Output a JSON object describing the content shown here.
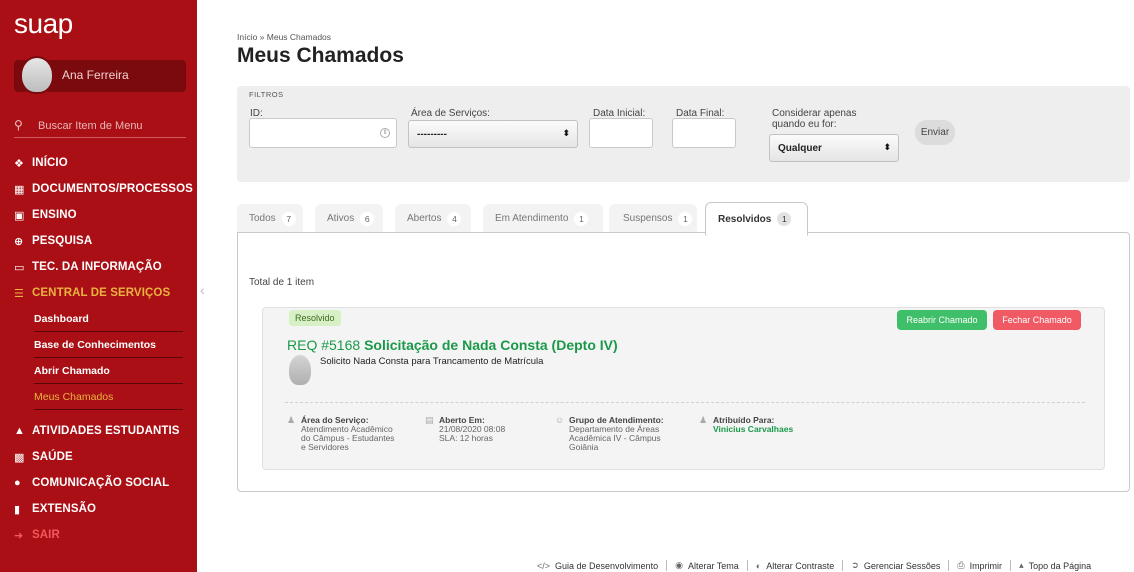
{
  "app": {
    "logo": "suap"
  },
  "user": {
    "name": "Ana Ferreira"
  },
  "search": {
    "placeholder": "Buscar Item de Menu"
  },
  "menu": {
    "items": [
      {
        "label": "INÍCIO",
        "icon": "home-icon"
      },
      {
        "label": "DOCUMENTOS/PROCESSOS",
        "icon": "documents-icon"
      },
      {
        "label": "ENSINO",
        "icon": "teaching-icon"
      },
      {
        "label": "PESQUISA",
        "icon": "research-icon"
      },
      {
        "label": "TEC. DA INFORMAÇÃO",
        "icon": "monitor-icon"
      },
      {
        "label": "CENTRAL DE SERVIÇOS",
        "icon": "list-icon"
      }
    ],
    "submenu": [
      {
        "label": "Dashboard"
      },
      {
        "label": "Base de Conhecimentos"
      },
      {
        "label": "Abrir Chamado"
      },
      {
        "label": "Meus Chamados"
      }
    ],
    "items_after": [
      {
        "label": "ATIVIDADES ESTUDANTIS",
        "icon": "graduation-icon"
      },
      {
        "label": "SAÚDE",
        "icon": "health-icon"
      },
      {
        "label": "COMUNICAÇÃO SOCIAL",
        "icon": "chat-icon"
      },
      {
        "label": "EXTENSÃO",
        "icon": "extension-icon"
      },
      {
        "label": "SAIR",
        "icon": "logout-icon"
      }
    ]
  },
  "breadcrumb": "Início » Meus Chamados",
  "page_title": "Meus Chamados",
  "filters": {
    "title": "FILTROS",
    "id_label": "ID:",
    "area_label": "Área de Serviços:",
    "area_value": "---------",
    "start_date_label": "Data Inicial:",
    "end_date_label": "Data Final:",
    "consider_label_1": "Considerar apenas",
    "consider_label_2": "quando eu for:",
    "consider_value": "Qualquer",
    "send_label": "Enviar"
  },
  "tabs": [
    {
      "label": "Todos",
      "count": "7"
    },
    {
      "label": "Ativos",
      "count": "6"
    },
    {
      "label": "Abertos",
      "count": "4"
    },
    {
      "label": "Em Atendimento",
      "count": "1"
    },
    {
      "label": "Suspensos",
      "count": "1"
    },
    {
      "label": "Resolvidos",
      "count": "1"
    }
  ],
  "panel": {
    "total": "Total de 1 item"
  },
  "ticket": {
    "status": "Resolvido",
    "reopen_label": "Reabrir Chamado",
    "close_label": "Fechar Chamado",
    "number": "REQ #5168",
    "title": "Solicitação de Nada Consta (Depto IV)",
    "description": "Solicito Nada Consta para Trancamento de Matrícula",
    "area_label": "Área do Serviço:",
    "area_value_1": "Atendimento Acadêmico",
    "area_value_2": "do Câmpus - Estudantes",
    "area_value_3": "e Servidores",
    "opened_label": "Aberto Em:",
    "opened_value": "21/08/2020 08:08",
    "sla_value": "SLA: 12 horas",
    "group_label": "Grupo de Atendimento:",
    "group_value_1": "Departamento de Áreas",
    "group_value_2": "Acadêmica IV - Câmpus",
    "group_value_3": "Goiânia",
    "assigned_label": "Atribuído Para:",
    "assigned_value": "Vinicius Carvalhaes"
  },
  "footer": {
    "dev_guide": "Guia de Desenvolvimento",
    "theme": "Alterar Tema",
    "contrast": "Alterar Contraste",
    "sessions": "Gerenciar Sessões",
    "print": "Imprimir",
    "top": "Topo da Página"
  },
  "colors": {
    "sidebar": "#a90f14",
    "active_menu": "#eab341",
    "link_green": "#1a9a49",
    "reopen_green": "#3fbf6a",
    "close_red": "#ef5a64"
  }
}
